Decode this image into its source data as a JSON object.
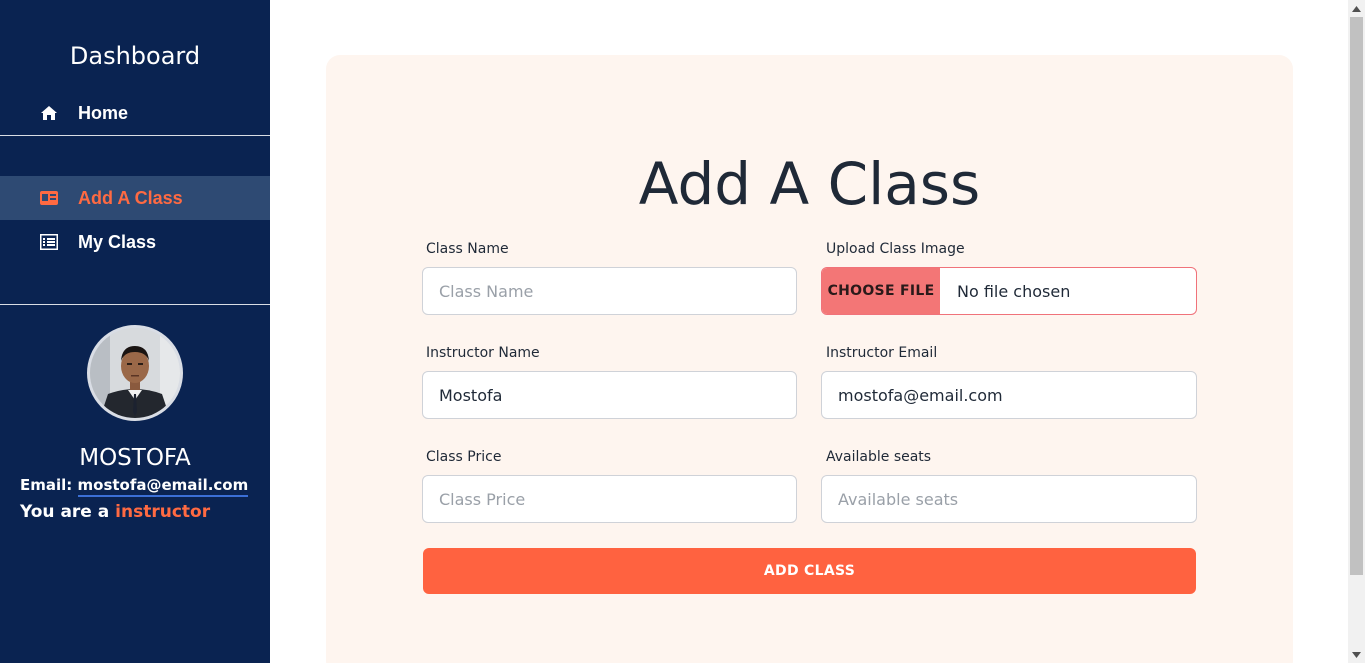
{
  "sidebar": {
    "title": "Dashboard",
    "nav": {
      "home": "Home",
      "add_class": "Add A Class",
      "my_class": "My Class"
    },
    "user": {
      "name": "MOSTOFA",
      "email_label": "Email:",
      "email": "mostofa@email.com",
      "role_prefix": "You are a",
      "role": "instructor"
    }
  },
  "form": {
    "title": "Add A Class",
    "class_name": {
      "label": "Class Name",
      "placeholder": "Class Name",
      "value": ""
    },
    "upload": {
      "label": "Upload Class Image",
      "button": "CHOOSE FILE",
      "status": "No file chosen"
    },
    "instructor_name": {
      "label": "Instructor Name",
      "value": "Mostofa"
    },
    "instructor_email": {
      "label": "Instructor Email",
      "value": "mostofa@email.com"
    },
    "class_price": {
      "label": "Class Price",
      "placeholder": "Class Price",
      "value": ""
    },
    "available_seats": {
      "label": "Available seats",
      "placeholder": "Available seats",
      "value": ""
    },
    "submit": "ADD CLASS"
  },
  "colors": {
    "sidebar_bg": "#0a2351",
    "accent": "#ff6240",
    "card_bg": "#fef5ef",
    "active_nav_bg": "#2e4a73"
  },
  "icons": {
    "home": "home-icon",
    "add_class": "id-card-icon",
    "my_class": "list-icon"
  }
}
